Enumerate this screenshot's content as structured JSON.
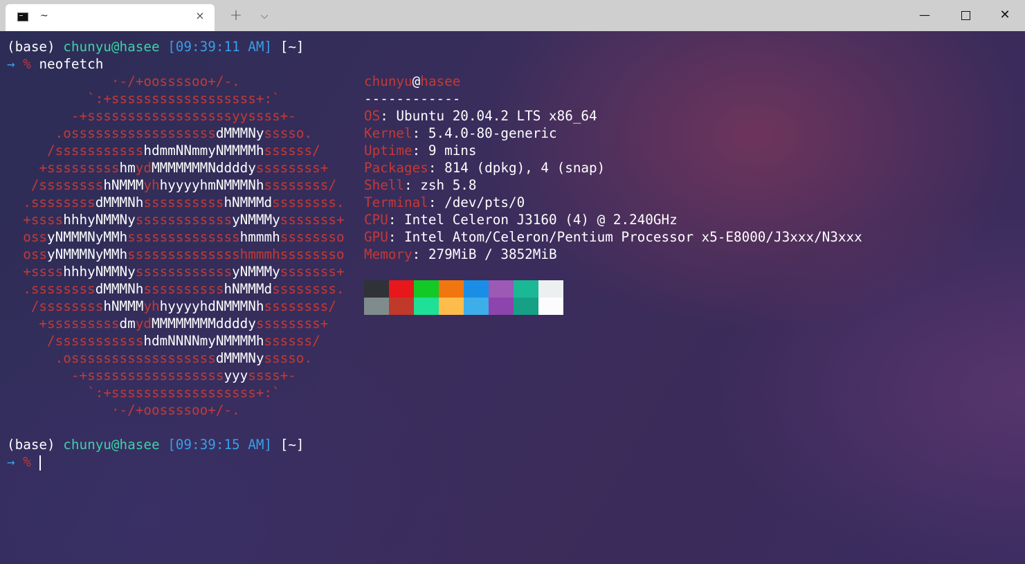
{
  "titlebar": {
    "tab_title": "~",
    "tab_close": "×",
    "new_tab": "+",
    "dropdown": "⌵",
    "minimize": "—",
    "close": "✕"
  },
  "prompt1": {
    "env": "(base)",
    "user_host": "chunyu@hasee",
    "time": "[09:39:11 AM]",
    "dir": "[~]",
    "arrow": "→",
    "symbol": "%",
    "command": "neofetch"
  },
  "logo_lines": [
    [
      [
        "r",
        "             ·-/+oossssoo+/-."
      ]
    ],
    [
      [
        "r",
        "          `:+ssssssssssssssssss+:`"
      ]
    ],
    [
      [
        "r",
        "        -+ssssssssssssssssssyyssss+-"
      ]
    ],
    [
      [
        "r",
        "      .ossssssssssssssssss"
      ],
      [
        "w",
        "dMMMNy"
      ],
      [
        "r",
        "sssso."
      ]
    ],
    [
      [
        "r",
        "     /sssssssssss"
      ],
      [
        "w",
        "hdmmNNmmyNMMMMh"
      ],
      [
        "r",
        "ssssss/"
      ]
    ],
    [
      [
        "r",
        "    +sssssssss"
      ],
      [
        "w",
        "hm"
      ],
      [
        "r",
        "yd"
      ],
      [
        "w",
        "MMMMMMMNddddy"
      ],
      [
        "r",
        "ssssssss+"
      ]
    ],
    [
      [
        "r",
        "   /ssssssss"
      ],
      [
        "w",
        "hNMMM"
      ],
      [
        "r",
        "yh"
      ],
      [
        "w",
        "hyyyyhmNMMMNh"
      ],
      [
        "r",
        "ssssssss/"
      ]
    ],
    [
      [
        "r",
        "  .ssssssss"
      ],
      [
        "w",
        "dMMMNh"
      ],
      [
        "r",
        "ssssssssss"
      ],
      [
        "w",
        "hNMMMd"
      ],
      [
        "r",
        "ssssssss."
      ]
    ],
    [
      [
        "r",
        "  +ssss"
      ],
      [
        "w",
        "hhhyNMMNy"
      ],
      [
        "r",
        "ssssssssssss"
      ],
      [
        "w",
        "yNMMMy"
      ],
      [
        "r",
        "sssssss+"
      ]
    ],
    [
      [
        "r",
        "  oss"
      ],
      [
        "w",
        "yNMMMNyMMh"
      ],
      [
        "r",
        "ssssssssssssss"
      ],
      [
        "w",
        "hmmmh"
      ],
      [
        "r",
        "ssssssso"
      ]
    ],
    [
      [
        "r",
        "  oss"
      ],
      [
        "w",
        "yNMMMNyMMh"
      ],
      [
        "r",
        "sssssssssssssshmmmhssssssso"
      ]
    ],
    [
      [
        "r",
        "  +ssss"
      ],
      [
        "w",
        "hhhyNMMNy"
      ],
      [
        "r",
        "ssssssssssss"
      ],
      [
        "w",
        "yNMMMy"
      ],
      [
        "r",
        "sssssss+"
      ]
    ],
    [
      [
        "r",
        "  .ssssssss"
      ],
      [
        "w",
        "dMMMNh"
      ],
      [
        "r",
        "ssssssssss"
      ],
      [
        "w",
        "hNMMMd"
      ],
      [
        "r",
        "ssssssss."
      ]
    ],
    [
      [
        "r",
        "   /ssssssss"
      ],
      [
        "w",
        "hNMMM"
      ],
      [
        "r",
        "yh"
      ],
      [
        "w",
        "hyyyyhdNMMMNh"
      ],
      [
        "r",
        "ssssssss/"
      ]
    ],
    [
      [
        "r",
        "    +sssssssss"
      ],
      [
        "w",
        "dm"
      ],
      [
        "r",
        "yd"
      ],
      [
        "w",
        "MMMMMMMMddddy"
      ],
      [
        "r",
        "ssssssss+"
      ]
    ],
    [
      [
        "r",
        "     /sssssssssss"
      ],
      [
        "w",
        "hdmNNNNmyNMMMMh"
      ],
      [
        "r",
        "ssssss/"
      ]
    ],
    [
      [
        "r",
        "      .ossssssssssssssssss"
      ],
      [
        "w",
        "dMMMNy"
      ],
      [
        "r",
        "sssso."
      ]
    ],
    [
      [
        "r",
        "        -+sssssssssssssssss"
      ],
      [
        "w",
        "yyy"
      ],
      [
        "r",
        "ssss+-"
      ]
    ],
    [
      [
        "r",
        "          `:+ssssssssssssssssss+:`"
      ]
    ],
    [
      [
        "r",
        "             ·-/+oossssoo+/-."
      ]
    ]
  ],
  "info": {
    "user": "chunyu",
    "at": "@",
    "host": "hasee",
    "separator": "------------",
    "rows": [
      {
        "label": "OS",
        "value": ": Ubuntu 20.04.2 LTS x86_64"
      },
      {
        "label": "Kernel",
        "value": ": 5.4.0-80-generic"
      },
      {
        "label": "Uptime",
        "value": ": 9 mins"
      },
      {
        "label": "Packages",
        "value": ": 814 (dpkg), 4 (snap)"
      },
      {
        "label": "Shell",
        "value": ": zsh 5.8"
      },
      {
        "label": "Terminal",
        "value": ": /dev/pts/0"
      },
      {
        "label": "CPU",
        "value": ": Intel Celeron J3160 (4) @ 2.240GHz"
      },
      {
        "label": "GPU",
        "value": ": Intel Atom/Celeron/Pentium Processor x5-E8000/J3xxx/N3xxx"
      },
      {
        "label": "Memory",
        "value": ": 279MiB / 3852MiB"
      }
    ]
  },
  "palette": {
    "row1": [
      "#2f3237",
      "#e8171b",
      "#13c926",
      "#f2760f",
      "#1a8ee6",
      "#9c59b6",
      "#1bb896",
      "#ecf0f1"
    ],
    "row2": [
      "#7f8c8d",
      "#c0392b",
      "#1ee096",
      "#fdbc4b",
      "#3daee9",
      "#8e44ad",
      "#16a085",
      "#fcfcfc"
    ]
  },
  "prompt2": {
    "env": "(base)",
    "user_host": "chunyu@hasee",
    "time": "[09:39:15 AM]",
    "dir": "[~]",
    "arrow": "→",
    "symbol": "%"
  }
}
